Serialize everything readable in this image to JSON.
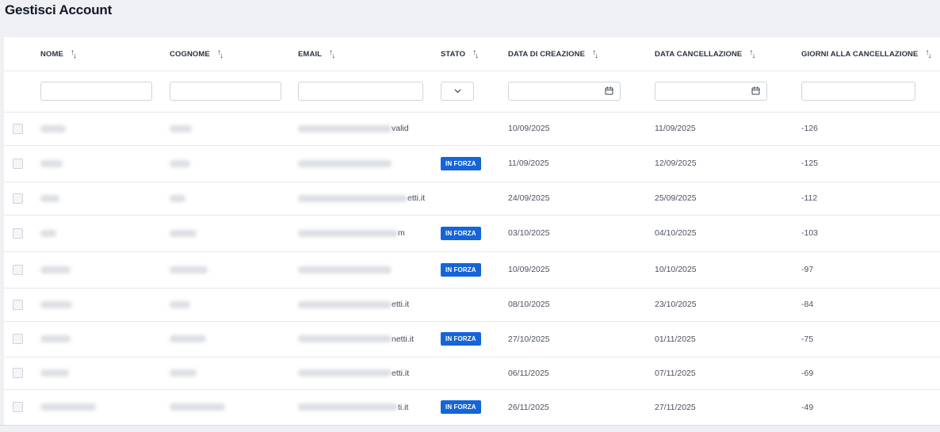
{
  "page": {
    "title": "Gestisci Account"
  },
  "table": {
    "columns": [
      {
        "key": "nome",
        "label": "NOME"
      },
      {
        "key": "cognome",
        "label": "COGNOME"
      },
      {
        "key": "email",
        "label": "EMAIL"
      },
      {
        "key": "stato",
        "label": "STATO"
      },
      {
        "key": "data_creazione",
        "label": "DATA DI CREAZIONE"
      },
      {
        "key": "data_cancellazione",
        "label": "DATA CANCELLAZIONE"
      },
      {
        "key": "giorni",
        "label": "GIORNI ALLA CANCELLAZIONE"
      }
    ],
    "sort_icon": "sort-arrows-icon",
    "filters": {
      "nome": "",
      "cognome": "",
      "email": "",
      "stato": "",
      "data_creazione": "",
      "data_cancellazione": "",
      "giorni": ""
    },
    "status_badge_color": "#1565d8",
    "rows": [
      {
        "email_suffix": "valid",
        "stato": "",
        "data_creazione": "10/09/2025",
        "data_cancellazione": "11/09/2025",
        "giorni": "-126"
      },
      {
        "email_suffix": "",
        "stato": "IN FORZA",
        "data_creazione": "11/09/2025",
        "data_cancellazione": "12/09/2025",
        "giorni": "-125"
      },
      {
        "email_suffix": "etti.it",
        "stato": "",
        "data_creazione": "24/09/2025",
        "data_cancellazione": "25/09/2025",
        "giorni": "-112"
      },
      {
        "email_suffix": "m",
        "stato": "IN FORZA",
        "data_creazione": "03/10/2025",
        "data_cancellazione": "04/10/2025",
        "giorni": "-103"
      },
      {
        "email_suffix": "",
        "stato": "IN FORZA",
        "data_creazione": "10/09/2025",
        "data_cancellazione": "10/10/2025",
        "giorni": "-97"
      },
      {
        "email_suffix": "etti.it",
        "stato": "",
        "data_creazione": "08/10/2025",
        "data_cancellazione": "23/10/2025",
        "giorni": "-84"
      },
      {
        "email_suffix": "netti.it",
        "stato": "IN FORZA",
        "data_creazione": "27/10/2025",
        "data_cancellazione": "01/11/2025",
        "giorni": "-75"
      },
      {
        "email_suffix": "etti.it",
        "stato": "",
        "data_creazione": "06/11/2025",
        "data_cancellazione": "07/11/2025",
        "giorni": "-69"
      },
      {
        "email_suffix": "ti.it",
        "stato": "IN FORZA",
        "data_creazione": "26/11/2025",
        "data_cancellazione": "27/11/2025",
        "giorni": "-49"
      }
    ]
  }
}
